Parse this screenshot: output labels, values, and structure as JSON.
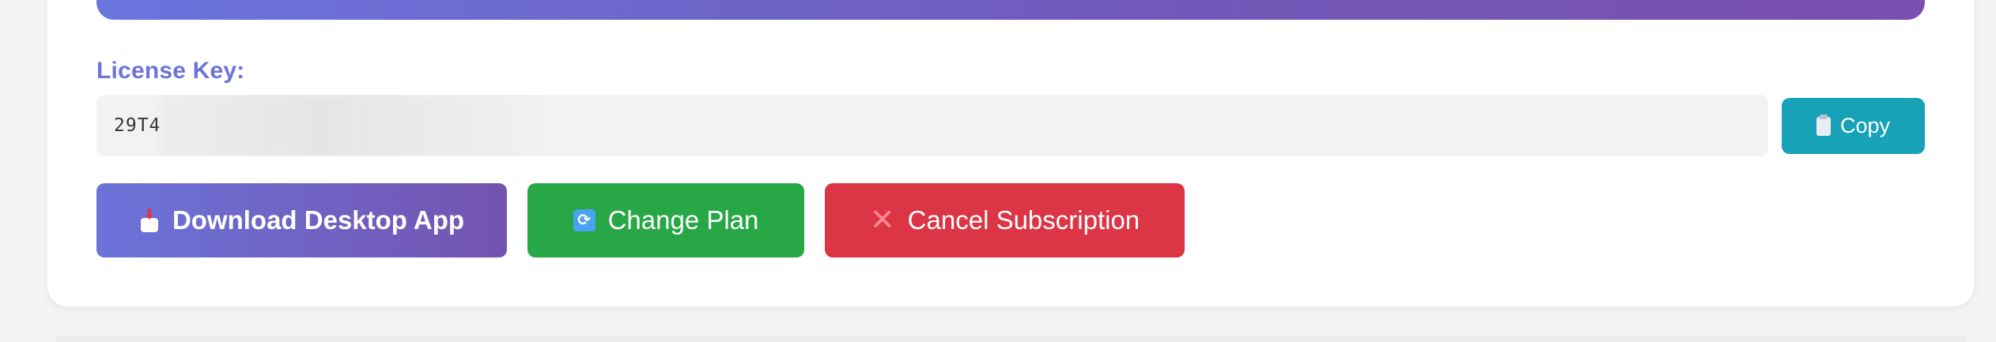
{
  "license": {
    "label": "License Key:",
    "value_visible": "29T4"
  },
  "actions": {
    "copy_label": "Copy",
    "download_label": "Download Desktop App",
    "change_plan_label": "Change Plan",
    "cancel_label": "Cancel Subscription"
  },
  "icons": {
    "download": "download-icon",
    "change_plan": "refresh-icon",
    "cancel": "close-icon",
    "copy": "clipboard-icon"
  },
  "colors": {
    "accent_gradient_start": "#6b74d9",
    "accent_gradient_end": "#7453b0",
    "copy": "#17a2b8",
    "change_plan": "#27a745",
    "cancel": "#dc3545",
    "label": "#6b74d9"
  }
}
